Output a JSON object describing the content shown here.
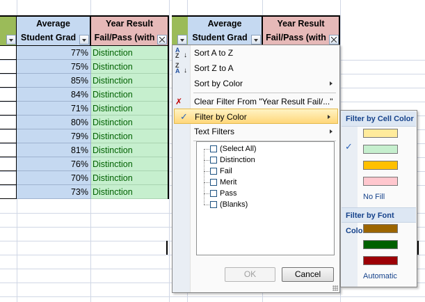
{
  "headers": {
    "avg_line1": "Average",
    "avg_line2": "Student Grad",
    "result_line1": "Year Result",
    "result_line2": "Fail/Pass (with",
    "result2_line2": "Fail/Pass (with"
  },
  "rows": [
    {
      "avg": "77%",
      "result": "Distinction"
    },
    {
      "avg": "75%",
      "result": "Distinction"
    },
    {
      "avg": "85%",
      "result": "Distinction"
    },
    {
      "avg": "84%",
      "result": "Distinction"
    },
    {
      "avg": "71%",
      "result": "Distinction"
    },
    {
      "avg": "80%",
      "result": "Distinction"
    },
    {
      "avg": "79%",
      "result": "Distinction"
    },
    {
      "avg": "81%",
      "result": "Distinction"
    },
    {
      "avg": "76%",
      "result": "Distinction"
    },
    {
      "avg": "70%",
      "result": "Distinction"
    },
    {
      "avg": "73%",
      "result": "Distinction"
    }
  ],
  "menu": {
    "sort_az": "Sort A to Z",
    "sort_za": "Sort Z to A",
    "sort_by_color": "Sort by Color",
    "clear_filter": "Clear Filter From \"Year Result Fail/...\"",
    "filter_by_color": "Filter by Color",
    "text_filters": "Text Filters",
    "items": [
      "(Select All)",
      "Distinction",
      "Fail",
      "Merit",
      "Pass",
      "(Blanks)"
    ],
    "ok": "OK",
    "cancel": "Cancel"
  },
  "submenu": {
    "cell_color_title": "Filter by Cell Color",
    "no_fill": "No Fill",
    "font_color_title": "Filter by Font Color",
    "automatic": "Automatic",
    "cell_colors": [
      "#ffeb9c",
      "#c6efce",
      "#ffc000",
      "#ffc7ce"
    ],
    "font_colors": [
      "#9c6500",
      "#006100",
      "#9c0006"
    ]
  },
  "colors": {
    "header_blue": "#c5d9f1",
    "header_pink": "#e6b9b8",
    "distinction_fill": "#c6efce",
    "distinction_text": "#006100"
  }
}
